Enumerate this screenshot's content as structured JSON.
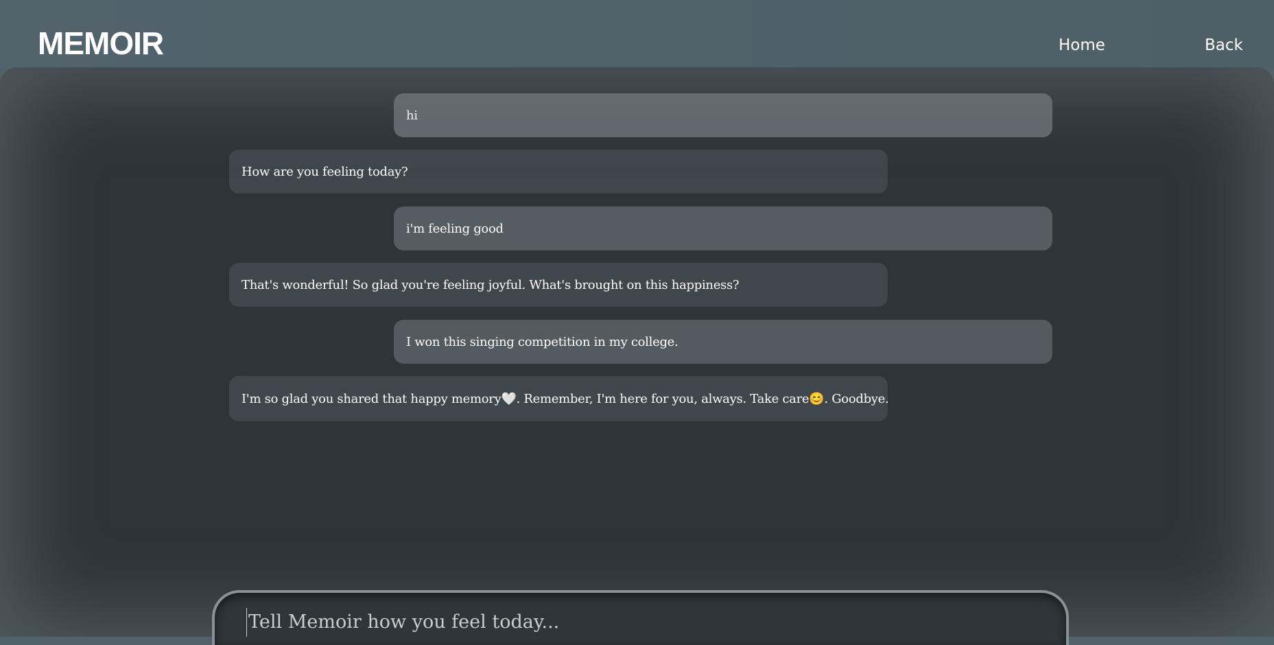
{
  "header": {
    "logo": "MEMOIR",
    "nav": {
      "home": "Home",
      "back": "Back"
    }
  },
  "chat": {
    "messages": [
      {
        "role": "user",
        "text": "hi"
      },
      {
        "role": "bot",
        "text": "How are you feeling today?"
      },
      {
        "role": "user",
        "text": "i'm feeling good"
      },
      {
        "role": "bot",
        "text": "That's wonderful! So glad you're feeling joyful. What's brought on this happiness?"
      },
      {
        "role": "user",
        "text": "I won this singing competition in my college."
      },
      {
        "role": "bot",
        "text": "I'm so glad you shared that happy memory🤍. Remember, I'm here for you, always. Take care😊. Goodbye."
      }
    ]
  },
  "composer": {
    "placeholder": "Tell Memoir how you feel today..."
  },
  "colors": {
    "header_bg": "#51626b",
    "panel_bg": "#2e3438",
    "user_bubble": "#5c6267",
    "bot_bubble": "#40474c",
    "text": "#ffffff"
  }
}
